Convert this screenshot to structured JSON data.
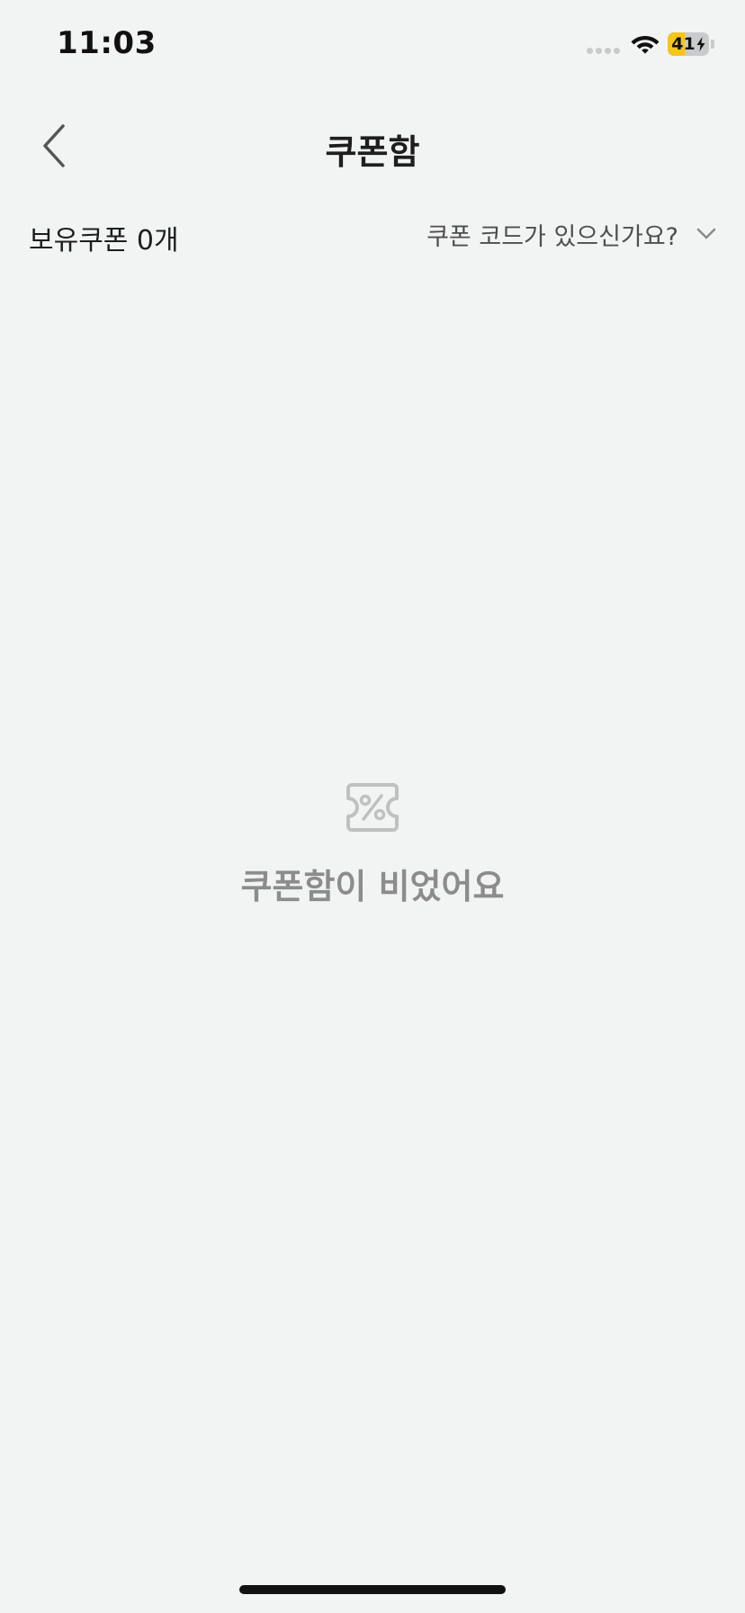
{
  "status_bar": {
    "time": "11:03",
    "battery_level": "41",
    "battery_percent": 41,
    "charging": true,
    "icons": [
      "signal-dots-icon",
      "wifi-icon",
      "battery-charging-icon"
    ]
  },
  "nav": {
    "title": "쿠폰함",
    "back_icon": "chevron-left-icon"
  },
  "coupon_header": {
    "owned_label": "보유쿠폰 0개",
    "code_prompt": "쿠폰 코드가 있으신가요?",
    "toggle_icon": "chevron-down-icon"
  },
  "empty_state": {
    "icon": "coupon-percent-icon",
    "message": "쿠폰함이 비었어요"
  },
  "colors": {
    "background": "#f2f4f3",
    "text_primary": "#1e1e1e",
    "text_secondary": "#4e4e4e",
    "empty_text": "#8c8c8c",
    "battery_accent": "#f5c518"
  }
}
